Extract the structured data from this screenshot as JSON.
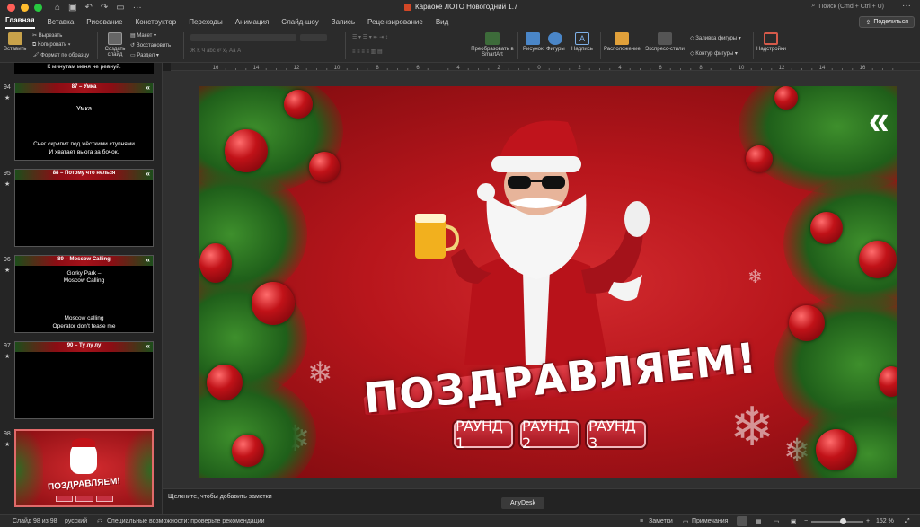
{
  "window": {
    "title": "Караоке ЛОТО Новогодний  1.7",
    "search_placeholder": "Поиск (Cmd + Ctrl + U)",
    "share_label": "Поделиться"
  },
  "tabs": [
    "Главная",
    "Вставка",
    "Рисование",
    "Конструктор",
    "Переходы",
    "Анимация",
    "Слайд-шоу",
    "Запись",
    "Рецензирование",
    "Вид"
  ],
  "ribbon": {
    "paste": "Вставить",
    "cut": "Вырезать",
    "copy": "Копировать",
    "format_painter": "Формат по образцу",
    "new_slide": "Создать слайд",
    "layout": "Макет",
    "reset": "Восстановить",
    "section": "Раздел",
    "smartart": "Преобразовать в SmartArt",
    "picture": "Рисунок",
    "shapes": "Фигуры",
    "textbox": "Надпись",
    "arrange": "Расположение",
    "quick_styles": "Экспресс-стили",
    "shape_fill": "Заливка фигуры",
    "shape_outline": "Контур фигуры",
    "addins": "Надстройки"
  },
  "ruler_ticks": [
    "16",
    "14",
    "12",
    "10",
    "8",
    "6",
    "4",
    "2",
    "0",
    "2",
    "4",
    "6",
    "8",
    "10",
    "12",
    "14",
    "16"
  ],
  "slides_panel": {
    "top_partial_text": "К минутам меня не ревнуй.",
    "slides": [
      {
        "num": "94",
        "title": "87 – Умка",
        "lines_top": [
          "Умка"
        ],
        "lines_bottom": [
          "Снег скрипит под жёсткими ступнями",
          "И хватает вьюга за бочок."
        ]
      },
      {
        "num": "95",
        "title": "88 – Потому что нельзя",
        "lines_top": [],
        "lines_bottom": []
      },
      {
        "num": "96",
        "title": "89 – Moscow Calling",
        "lines_top": [
          "Gorky Park –",
          "Moscow Calling"
        ],
        "lines_bottom": [
          "Moscow calling",
          "Operator don't tease me"
        ]
      },
      {
        "num": "97",
        "title": "90 – Ту лу лу",
        "lines_top": [],
        "lines_bottom": []
      },
      {
        "num": "98",
        "title": "",
        "lines_top": [],
        "lines_bottom": []
      }
    ]
  },
  "slide": {
    "headline": "ПОЗДРАВЛЯЕМ!",
    "back_chevron": "«",
    "rounds": [
      "РАУНД 1",
      "РАУНД 2",
      "РАУНД 3"
    ]
  },
  "notes_placeholder": "Щелкните, чтобы добавить заметки",
  "anydesk_label": "AnyDesk",
  "status": {
    "slide_counter": "Слайд 98 из 98",
    "language": "русский",
    "accessibility": "Специальные возможности: проверьте рекомендации",
    "notes": "Заметки",
    "comments": "Примечания",
    "zoom": "152 %",
    "zoom_fraction": 0.6
  },
  "colors": {
    "slide_red": "#b8161c",
    "accent_red": "#d33a44",
    "pine_green": "#2d6b22"
  }
}
